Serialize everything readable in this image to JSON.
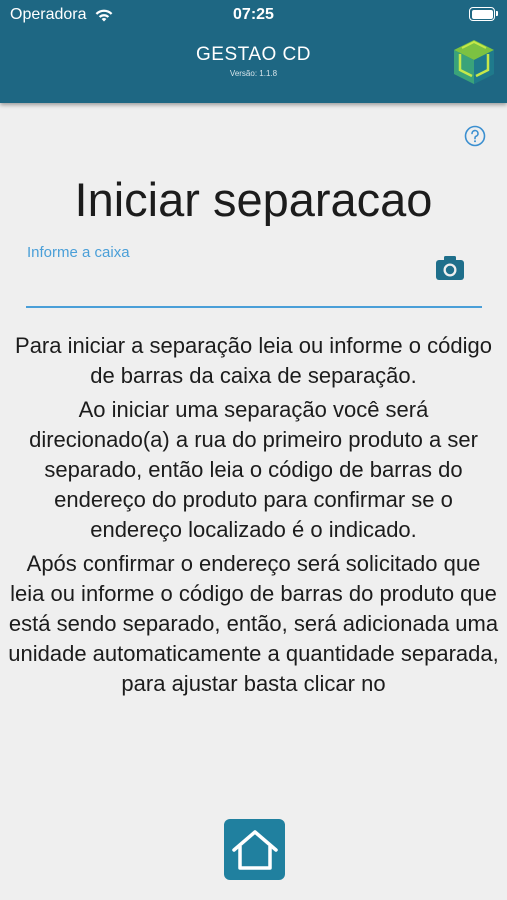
{
  "status_bar": {
    "carrier": "Operadora",
    "time": "07:25",
    "wifi_icon": "wifi-icon",
    "battery_icon": "battery-icon"
  },
  "header": {
    "title": "GESTAO CD",
    "version": "Versão: 1.1.8",
    "logo_icon": "cube-logo-icon",
    "background_color": "#1e6783"
  },
  "help_icon": "help-circle-icon",
  "page": {
    "title": "Iniciar separacao"
  },
  "case_field": {
    "label": "Informe a caixa",
    "value": "",
    "camera_icon": "camera-icon",
    "accent_color": "#4a9fd8"
  },
  "instructions": [
    "Para iniciar a separação leia ou informe o código de barras da caixa de separação.",
    "Ao iniciar uma separação você será direcionado(a) a rua do primeiro produto a ser separado, então leia o código de barras do endereço do produto para confirmar se o endereço localizado é o indicado.",
    "Após confirmar o endereço será solicitado que leia ou informe o código de barras do produto que está sendo separado, então, será adicionada uma unidade automaticamente a quantidade separada, para ajustar basta clicar no"
  ],
  "footer": {
    "home_icon": "home-icon",
    "button_color": "#20809f"
  }
}
